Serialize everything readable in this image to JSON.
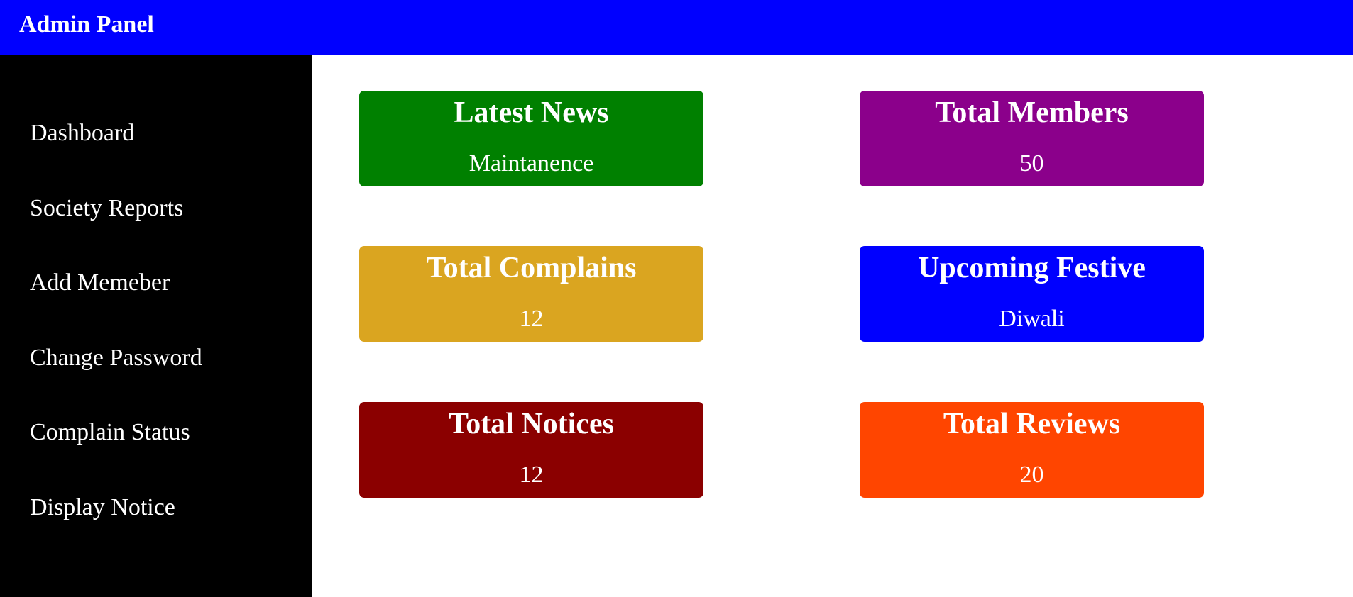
{
  "header": {
    "title": "Admin Panel",
    "background": "#0000ff"
  },
  "sidebar": {
    "background": "#000000",
    "items": [
      {
        "label": "Dashboard"
      },
      {
        "label": "Society Reports"
      },
      {
        "label": "Add Memeber"
      },
      {
        "label": "Change Password"
      },
      {
        "label": "Complain Status"
      },
      {
        "label": "Display Notice"
      }
    ]
  },
  "cards": [
    {
      "title": "Latest News",
      "value": "Maintanence",
      "color": "#008000"
    },
    {
      "title": "Total Members",
      "value": "50",
      "color": "#8b008b"
    },
    {
      "title": "Total Complains",
      "value": "12",
      "color": "#daa520"
    },
    {
      "title": "Upcoming Festive",
      "value": "Diwali",
      "color": "#0000ff"
    },
    {
      "title": "Total Notices",
      "value": "12",
      "color": "#8b0000"
    },
    {
      "title": "Total Reviews",
      "value": "20",
      "color": "#ff4500"
    }
  ]
}
